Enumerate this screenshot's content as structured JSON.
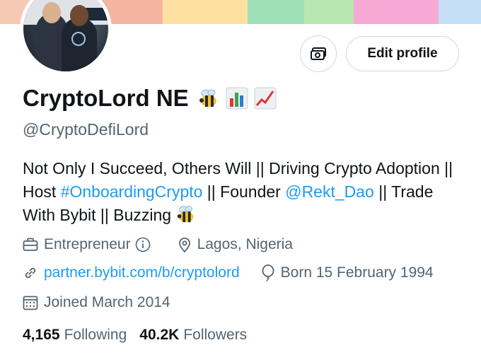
{
  "banner": {
    "colors": [
      "#f6c9b4",
      "#f4b49f",
      "#fbe0a0",
      "#9fe0b8",
      "#b7e6b0",
      "#f5a9d4",
      "#c4dff7"
    ]
  },
  "profile": {
    "display_name": "CryptoLord NE",
    "name_emojis": [
      "bee-emoji",
      "bar-chart-emoji",
      "chart-increasing-emoji"
    ],
    "handle": "@CryptoDefiLord",
    "edit_profile_label": "Edit profile",
    "tip_icon": "money-icon"
  },
  "bio": {
    "part1": "Not Only I Succeed, Others Will || Driving Crypto Adoption || Host ",
    "hashtag": "#OnboardingCrypto",
    "part2": " || Founder ",
    "mention": "@Rekt_Dao",
    "part3": " || Trade With Bybit || Buzzing ",
    "end_emoji": "bee-emoji"
  },
  "meta": {
    "profession": "Entrepreneur",
    "location": "Lagos, Nigeria",
    "website": "partner.bybit.com/b/cryptolord",
    "birthday": "Born 15 February 1994",
    "joined": "Joined March 2014"
  },
  "stats": {
    "following_count": "4,165",
    "following_label": "Following",
    "followers_count": "40.2K",
    "followers_label": "Followers"
  },
  "colors": {
    "link": "#1d9bf0",
    "secondary_text": "#536471",
    "border": "#cfd9de"
  }
}
